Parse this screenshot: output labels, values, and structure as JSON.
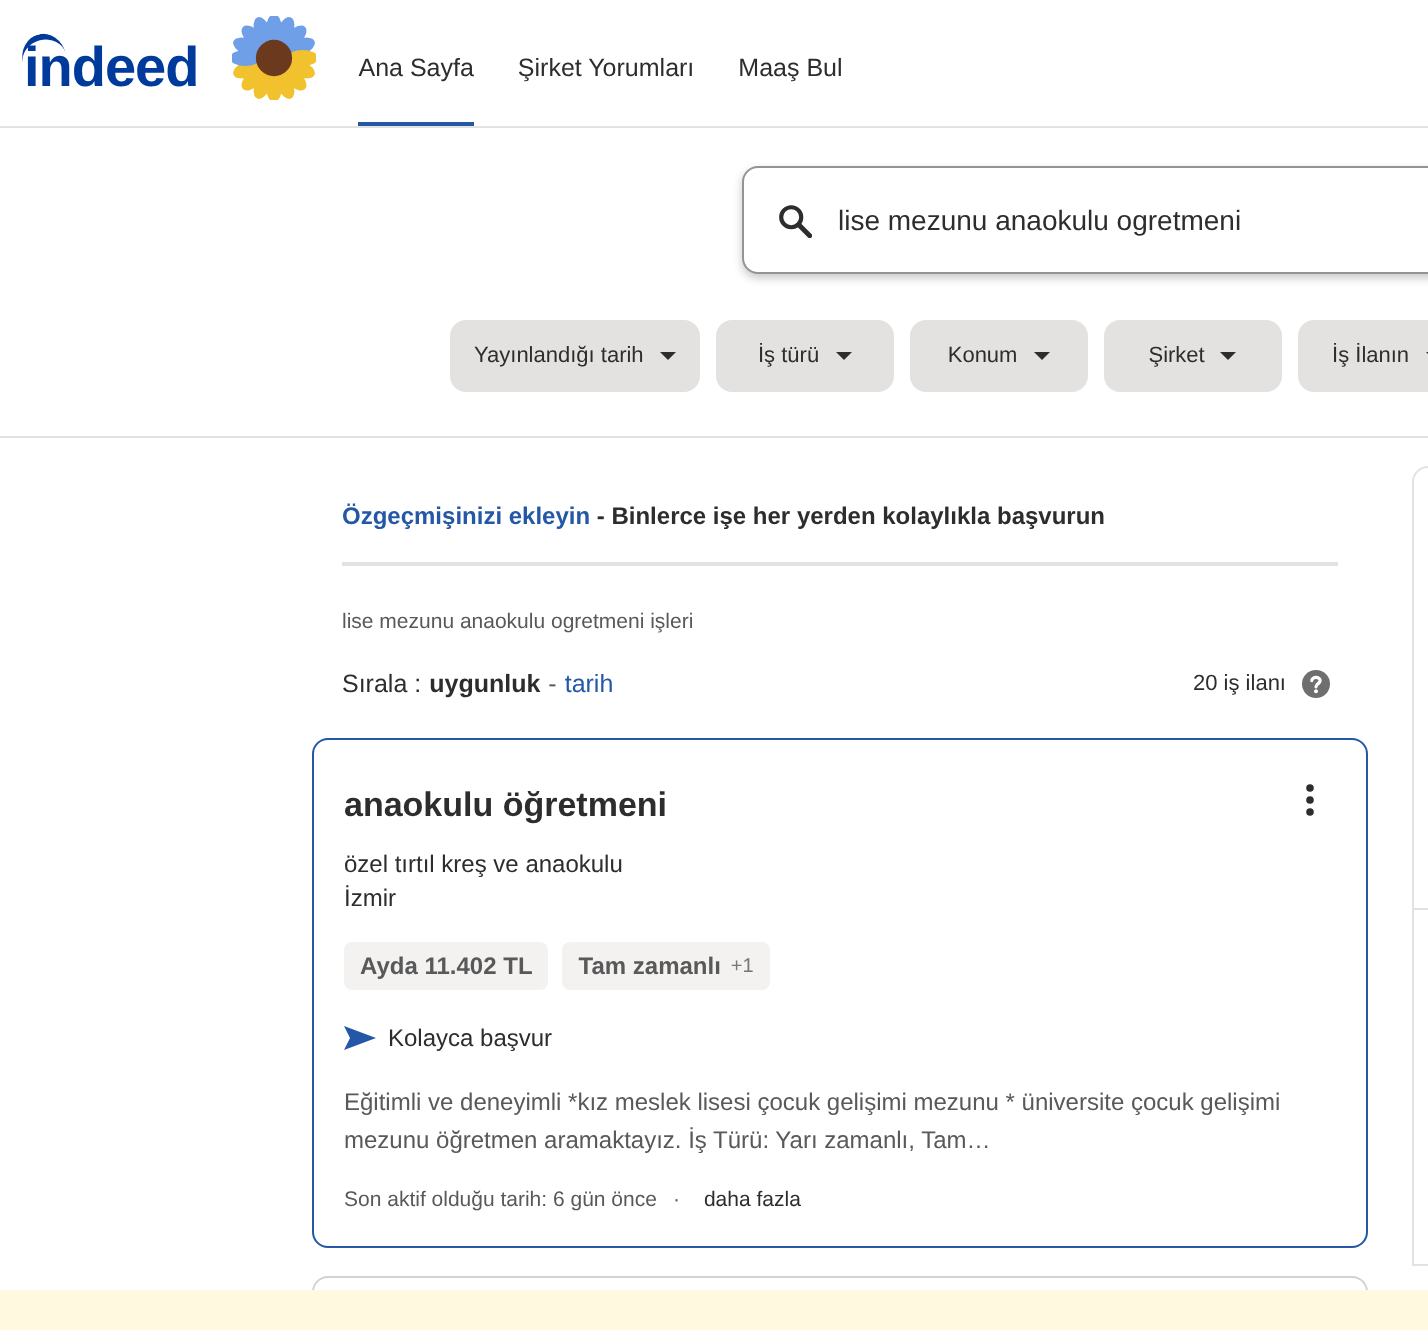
{
  "header": {
    "logo": "indeed",
    "nav": [
      {
        "label": "Ana Sayfa",
        "selected": true
      },
      {
        "label": "Şirket Yorumları",
        "selected": false
      },
      {
        "label": "Maaş Bul",
        "selected": false
      }
    ]
  },
  "search": {
    "value": "lise mezunu anaokulu ogretmeni"
  },
  "filters": [
    {
      "label": "Yayınlandığı tarih"
    },
    {
      "label": "İş türü"
    },
    {
      "label": "Konum"
    },
    {
      "label": "Şirket"
    },
    {
      "label": "İş İlanın"
    }
  ],
  "resume_prompt": {
    "link": "Özgeçmişinizi ekleyin",
    "text": "- Binlerce işe her yerden kolaylıkla başvurun"
  },
  "results": {
    "heading": "lise mezunu anaokulu ogretmeni işleri",
    "count": "20 iş ilanı"
  },
  "sort": {
    "label": "Sırala :",
    "separator": "-",
    "options": [
      {
        "label": "uygunluk",
        "selected": true
      },
      {
        "label": "tarih",
        "selected": false
      }
    ]
  },
  "jobs": [
    {
      "selected": true,
      "title": "anaokulu öğretmeni",
      "company": "özel tırtıl kreş ve anaokulu",
      "location": "İzmir",
      "salary": "Ayda 11.402 TL",
      "job_type": {
        "label": "Tam zamanlı",
        "extra": "+1"
      },
      "apply": "Kolayca başvur",
      "snippet": "Eğitimli ve deneyimli *kız meslek lisesi çocuk gelişimi mezunu * üniversite çocuk gelişimi mezunu öğretmen aramaktayız. İş Türü: Yarı zamanlı, Tam…",
      "activity": "Son aktif olduğu tarih: 6 gün önce",
      "separator": "·",
      "more": "daha fazla"
    },
    {
      "selected": false
    }
  ]
}
